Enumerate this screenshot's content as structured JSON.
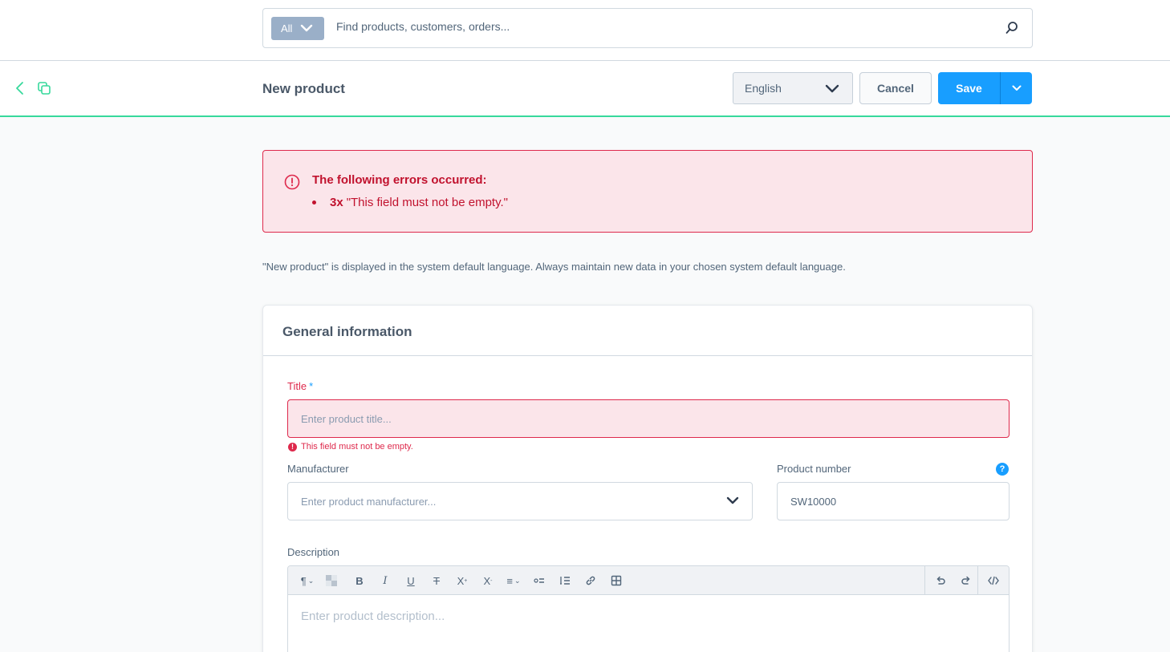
{
  "search": {
    "type_label": "All",
    "placeholder": "Find products, customers, orders..."
  },
  "smartbar": {
    "title": "New product",
    "language": "English",
    "cancel_label": "Cancel",
    "save_label": "Save"
  },
  "alert": {
    "title": "The following errors occurred:",
    "items": [
      {
        "count": "3x",
        "message": "\"This field must not be empty.\""
      }
    ]
  },
  "language_info": "\"New product\" is displayed in the system default language. Always maintain new data in your chosen system default language.",
  "card": {
    "title": "General information",
    "fields": {
      "title": {
        "label": "Title",
        "required_mark": "*",
        "placeholder": "Enter product title...",
        "error": "This field must not be empty."
      },
      "manufacturer": {
        "label": "Manufacturer",
        "placeholder": "Enter product manufacturer..."
      },
      "product_number": {
        "label": "Product number",
        "value": "SW10000",
        "help": "?"
      },
      "description": {
        "label": "Description",
        "placeholder": "Enter product description..."
      }
    }
  },
  "colors": {
    "primary": "#189eff",
    "accent_green": "#37d99c",
    "error": "#de294c",
    "error_bg": "#fbe5ea"
  }
}
